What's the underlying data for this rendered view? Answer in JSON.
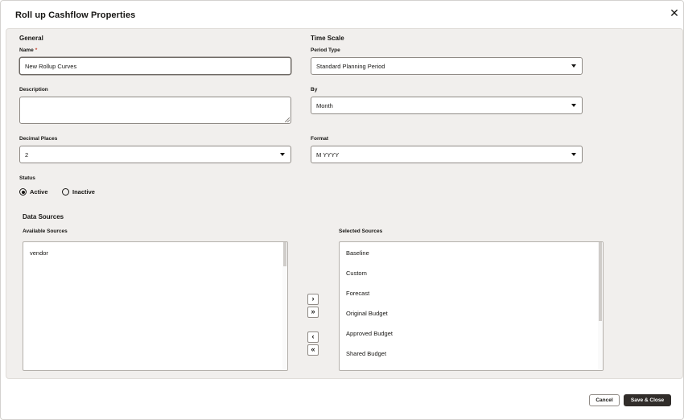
{
  "dialog": {
    "title": "Roll up Cashflow Properties",
    "close_glyph": "✕"
  },
  "general": {
    "heading": "General",
    "name_label": "Name",
    "required_mark": "*",
    "name_value": "New Rollup Curves",
    "description_label": "Description",
    "description_value": "",
    "decimal_label": "Decimal Places",
    "decimal_value": "2",
    "status_label": "Status",
    "status_options": [
      {
        "label": "Active",
        "selected": true
      },
      {
        "label": "Inactive",
        "selected": false
      }
    ]
  },
  "time_scale": {
    "heading": "Time Scale",
    "period_type_label": "Period Type",
    "period_type_value": "Standard Planning Period",
    "by_label": "By",
    "by_value": "Month",
    "format_label": "Format",
    "format_value": "M YYYY"
  },
  "data_sources": {
    "heading": "Data Sources",
    "available_label": "Available Sources",
    "available": [
      "vendor"
    ],
    "selected_label": "Selected Sources",
    "selected": [
      "Baseline",
      "Custom",
      "Forecast",
      "Original Budget",
      "Approved Budget",
      "Shared Budget"
    ],
    "move_right": "›",
    "move_all_right": "»",
    "move_left": "‹",
    "move_all_left": "«"
  },
  "footer": {
    "cancel_label": "Cancel",
    "save_label": "Save & Close"
  }
}
